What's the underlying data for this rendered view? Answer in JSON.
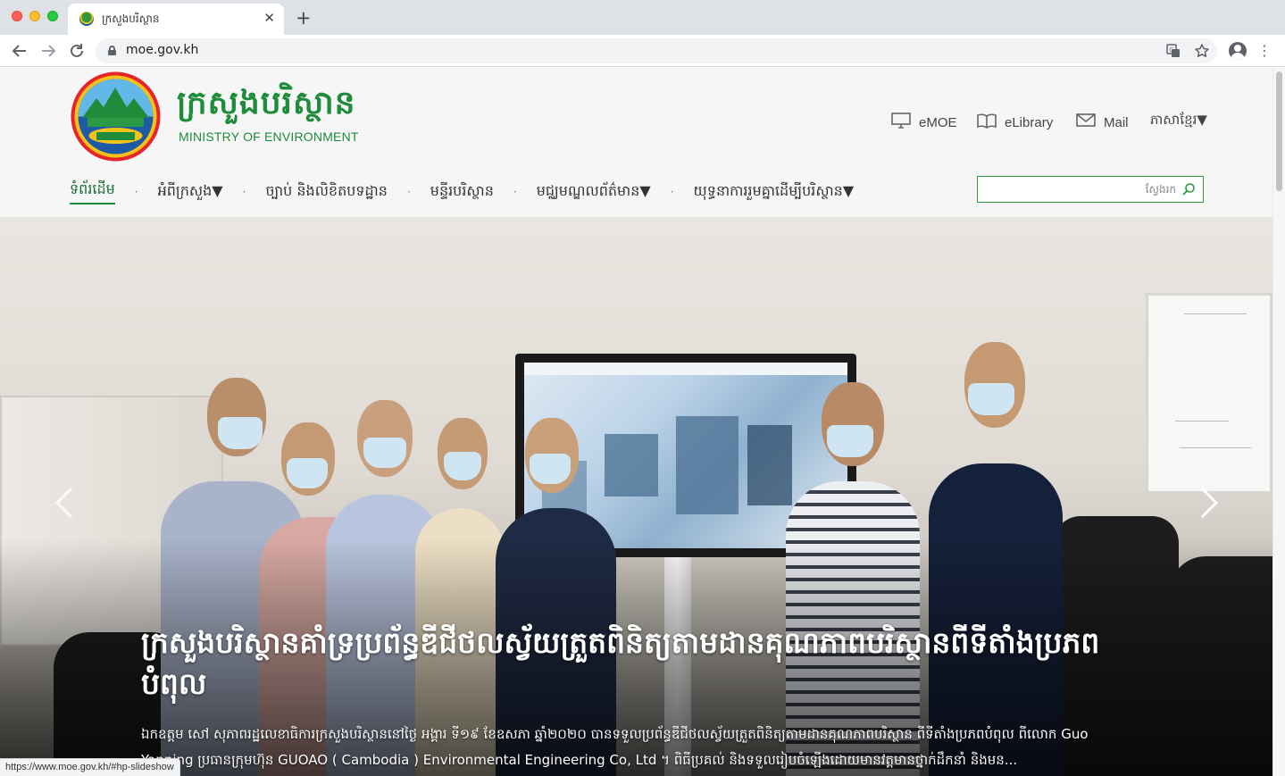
{
  "browser": {
    "tab_title": "ក្រសួងបរិស្ថាន",
    "tab_close": "✕",
    "new_tab": "+",
    "url": "moe.gov.kh",
    "status_url": "https://www.moe.gov.kh/#hp-slideshow"
  },
  "site": {
    "logo_kh": "ក្រសួងបរិស្ថាន",
    "logo_en": "MINISTRY OF ENVIRONMENT",
    "utility_links": [
      {
        "label": "eMOE",
        "icon": "monitor-icon"
      },
      {
        "label": "eLibrary",
        "icon": "book-icon"
      },
      {
        "label": "Mail",
        "icon": "envelope-icon"
      }
    ],
    "language": "ភាសាខ្មែរ▼",
    "nav": [
      "ទំព័រដើម",
      "អំពីក្រសួង▼",
      "ច្បាប់ និងលិខិតបទដ្ឋាន",
      "មន្ទីរបរិស្ថាន",
      "មជ្ឈមណ្ឌលព័ត៌មាន▼",
      "យុទ្ធនាការរួមគ្នាដើម្បីបរិស្ថាន▼"
    ],
    "nav_separator": "·",
    "search_placeholder": "ស្វែងរក"
  },
  "slide": {
    "title": "ក្រសួងបរិស្ថានគាំទ្រប្រព័ន្ធឌីជីថលស្វ័យត្រួតពិនិត្យតាមដានគុណភាពបរិស្ថានពីទីតាំងប្រភពបំពុល",
    "description": "ឯកឧត្តម សៅ សុភាពរដ្ឋលេខាធិការក្រសួងបរិស្ថាននៅថ្ងៃ អង្គារ ទី១៩ ខែឧសភា ឆ្នាំ២០២០ បានទទួលប្រព័ន្ធឌីជីថលស្វ័យត្រួតពិនិត្យតាមដានគុណភាពបរិស្ថាន ពីទីតាំងប្រភពបំពុល ពីលោក Guo Yanping ប្រធានក្រុមហ៊ុន GUOAO ( Cambodia ) Environmental Engineering Co, Ltd ។ ពិធីប្រគល់ និងទទួលរៀបចំឡើងដោយមានវត្តមានថ្នាក់ដឹកនាំ និងមន..."
  },
  "colors": {
    "brand_green": "#1e8c3a",
    "chrome_tabbar": "#dee1e6"
  }
}
